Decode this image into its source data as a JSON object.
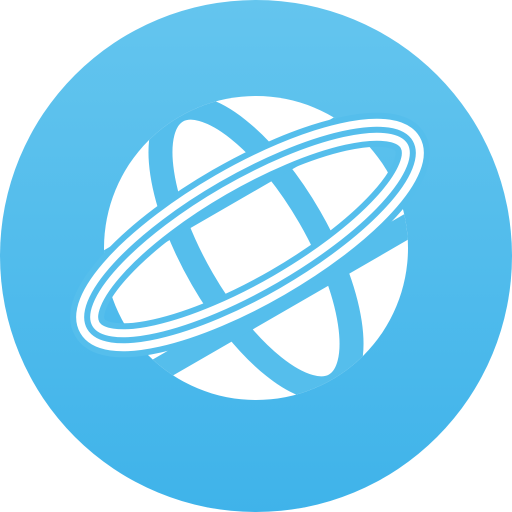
{
  "icon": {
    "name": "globe-orbit-icon",
    "background_top": "#64C5EE",
    "background_bottom": "#3FB3EA",
    "foreground": "#FFFFFF"
  }
}
